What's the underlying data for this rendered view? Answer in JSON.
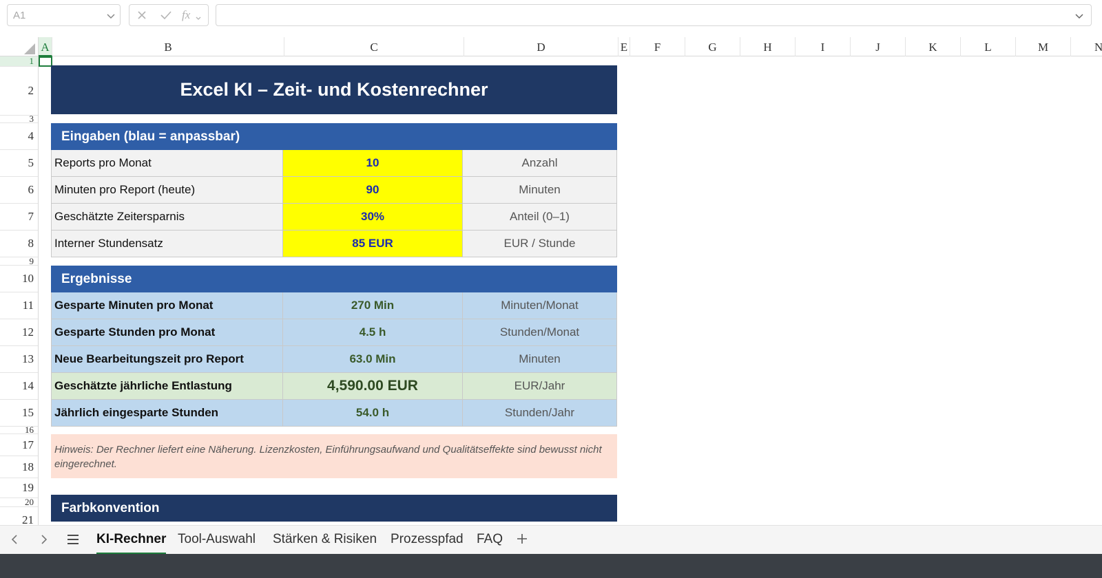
{
  "formula_bar": {
    "name_box": "A1",
    "fx_label": "fx",
    "formula": ""
  },
  "columns": [
    "A",
    "B",
    "C",
    "D",
    "E",
    "F",
    "G",
    "H",
    "I",
    "J",
    "K",
    "L",
    "M",
    "N"
  ],
  "rows": [
    "1",
    "2",
    "3",
    "4",
    "5",
    "6",
    "7",
    "8",
    "9",
    "10",
    "11",
    "12",
    "13",
    "14",
    "15",
    "16",
    "17",
    "18",
    "19",
    "20",
    "21"
  ],
  "sheet": {
    "title": "Excel KI – Zeit- und Kostenrechner",
    "inputs_header": "Eingaben (blau = anpassbar)",
    "inputs": [
      {
        "label": "Reports pro Monat",
        "value": "10",
        "unit": "Anzahl"
      },
      {
        "label": "Minuten pro Report (heute)",
        "value": "90",
        "unit": "Minuten"
      },
      {
        "label": "Geschätzte Zeitersparnis",
        "value": "30%",
        "unit": "Anteil (0–1)"
      },
      {
        "label": "Interner Stundensatz",
        "value": "85 EUR",
        "unit": "EUR / Stunde"
      }
    ],
    "results_header": "Ergebnisse",
    "results": [
      {
        "label": "Gesparte Minuten pro Monat",
        "value": "270 Min",
        "unit": "Minuten/Monat"
      },
      {
        "label": "Gesparte Stunden pro Monat",
        "value": "4.5 h",
        "unit": "Stunden/Monat"
      },
      {
        "label": "Neue Bearbeitungszeit pro Report",
        "value": "63.0 Min",
        "unit": "Minuten"
      },
      {
        "label": "Geschätzte jährliche Entlastung",
        "value": "4,590.00 EUR",
        "unit": "EUR/Jahr"
      },
      {
        "label": "Jährlich eingesparte Stunden",
        "value": "54.0 h",
        "unit": "Stunden/Jahr"
      }
    ],
    "note": "Hinweis: Der Rechner liefert eine Näherung. Lizenzkosten, Einführungsaufwand und Qualitätseffekte sind bewusst nicht eingerechnet.",
    "color_header": "Farbkonvention"
  },
  "tabs": [
    "KI-Rechner",
    "Tool-Auswahl",
    "Stärken & Risiken",
    "Prozesspfad",
    "FAQ"
  ],
  "active_tab": "KI-Rechner",
  "icons": {
    "prev": "chevron-left-icon",
    "next": "chevron-right-icon",
    "menu": "hamburger-menu-icon",
    "add": "plus-icon"
  },
  "colors": {
    "title_bg": "#1f3864",
    "section_bg": "#2f5ea7",
    "input_value_bg": "#ffff00",
    "input_value_text": "#1a2bb0",
    "result_bg": "#bdd7ee",
    "highlight_bg": "#d9ead3",
    "note_bg": "#fde0d5",
    "accent": "#1e7d3c"
  }
}
